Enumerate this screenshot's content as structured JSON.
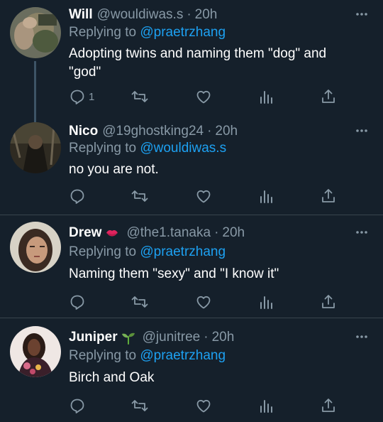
{
  "tweets": [
    {
      "name": "Will",
      "handle": "@wouldiwas.s",
      "time": "20h",
      "reply_label": "Replying to ",
      "reply_to": "@praetrzhang",
      "text": "Adopting twins and naming them \"dog\" and \"god\"",
      "reply_count": "1",
      "avatar": "user-avatar"
    },
    {
      "name": "Nico",
      "handle": "@19ghostking24",
      "time": "20h",
      "reply_label": "Replying to ",
      "reply_to": "@wouldiwas.s",
      "text": "no you are not.",
      "reply_count": "",
      "avatar": "user-avatar"
    },
    {
      "name": "Drew",
      "name_emoji": "kiss-mark-emoji",
      "handle": "@the1.tanaka",
      "time": "20h",
      "reply_label": "Replying to ",
      "reply_to": "@praetrzhang",
      "text": "Naming them \"sexy\" and \"I know it\"",
      "reply_count": "",
      "avatar": "user-avatar"
    },
    {
      "name": "Juniper",
      "name_emoji": "seedling-emoji",
      "handle": "@junitree",
      "time": "20h",
      "reply_label": "Replying to ",
      "reply_to": "@praetrzhang",
      "text": "Birch and Oak",
      "reply_count": "",
      "avatar": "user-avatar"
    }
  ],
  "icons": {
    "reply": "reply-icon",
    "retweet": "retweet-icon",
    "like": "like-icon",
    "analytics": "analytics-icon",
    "share": "share-icon",
    "more": "more-icon"
  },
  "colors": {
    "background": "#15202b",
    "secondary_text": "#8899a6",
    "link": "#1da1f2",
    "divider": "#38444d"
  },
  "separator": "·"
}
